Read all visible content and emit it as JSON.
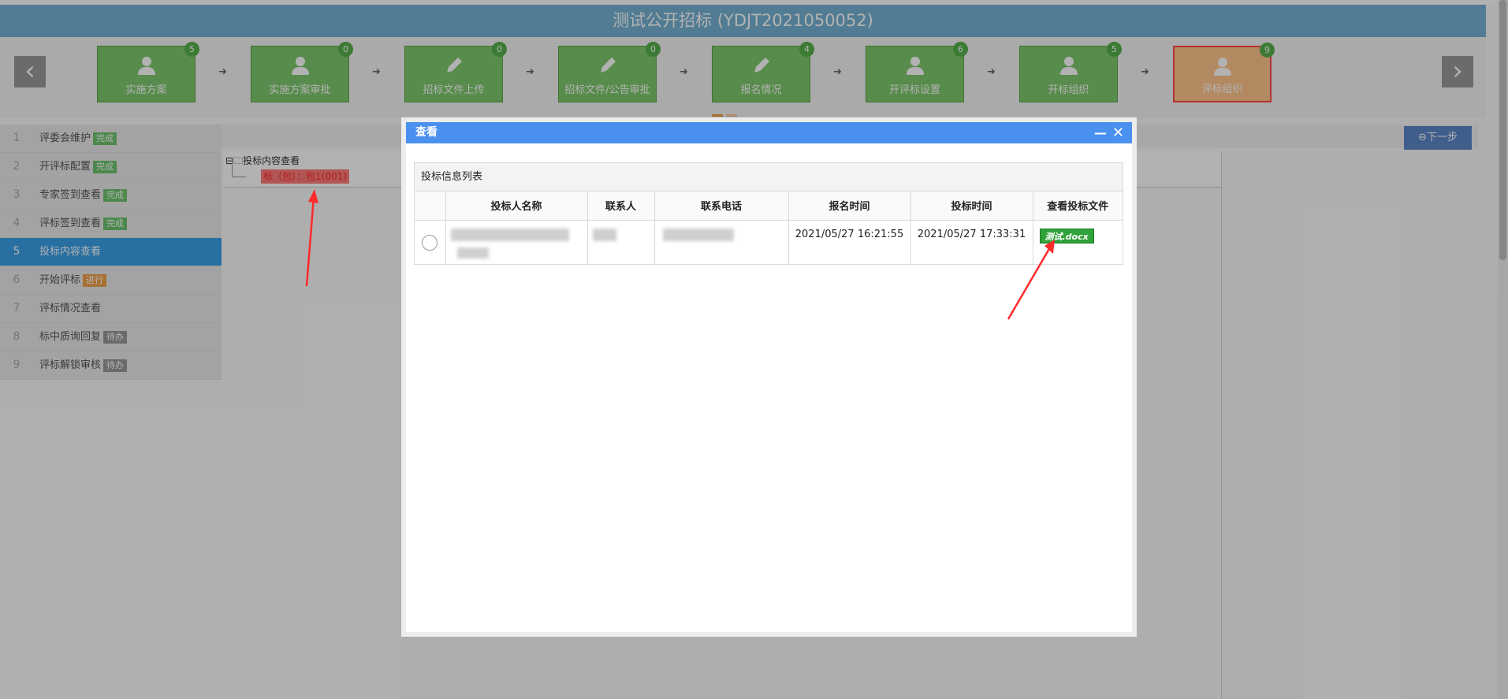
{
  "header": {
    "title": "测试公开招标 (YDJT2021050052)"
  },
  "workflow": {
    "prev_arrow": "‹",
    "next_arrow": "›",
    "steps": [
      {
        "label": "实施方案",
        "count": "5",
        "icon": "user-icon"
      },
      {
        "label": "实施方案审批",
        "count": "0",
        "icon": "user-icon"
      },
      {
        "label": "招标文件上传",
        "count": "0",
        "icon": "pencil-icon"
      },
      {
        "label": "招标文件/公告审批",
        "count": "0",
        "icon": "pencil-icon"
      },
      {
        "label": "报名情况",
        "count": "4",
        "icon": "pencil-icon"
      },
      {
        "label": "开评标设置",
        "count": "6",
        "icon": "user-icon"
      },
      {
        "label": "开标组织",
        "count": "5",
        "icon": "user-icon"
      },
      {
        "label": "评标组织",
        "count": "9",
        "icon": "user-icon",
        "active": true
      }
    ]
  },
  "sidebar": {
    "items": [
      {
        "num": "1",
        "label": "评委会维护",
        "tag": "完成",
        "tag_color": "#6ec36e"
      },
      {
        "num": "2",
        "label": "开评标配置",
        "tag": "完成",
        "tag_color": "#6ec36e"
      },
      {
        "num": "3",
        "label": "专家签到查看",
        "tag": "完成",
        "tag_color": "#6ec36e"
      },
      {
        "num": "4",
        "label": "评标签到查看",
        "tag": "完成",
        "tag_color": "#6ec36e"
      },
      {
        "num": "5",
        "label": "投标内容查看",
        "tag": "",
        "active": true
      },
      {
        "num": "6",
        "label": "开始评标",
        "tag": "进行",
        "tag_color": "#f0a34a"
      },
      {
        "num": "7",
        "label": "评标情况查看",
        "tag": ""
      },
      {
        "num": "8",
        "label": "标中质询回复",
        "tag": "待办",
        "tag_color": "#999999"
      },
      {
        "num": "9",
        "label": "评标解锁审核",
        "tag": "待办",
        "tag_color": "#999999"
      }
    ]
  },
  "toolbar": {
    "next_step": "下一步"
  },
  "tree": {
    "root": "投标内容查看",
    "child": "标（包）：包1(001)"
  },
  "dialog": {
    "title": "查看",
    "grid_caption": "投标信息列表",
    "columns": [
      "投标人名称",
      "联系人",
      "联系电话",
      "报名时间",
      "投标时间",
      "查看投标文件"
    ],
    "rows": [
      {
        "bidder": "",
        "contact": "",
        "phone": "",
        "signup_time": "2021/05/27 16:21:55",
        "bid_time": "2021/05/27 17:33:31",
        "file": "测试.docx"
      }
    ]
  },
  "colors": {
    "title_bar": "#75b2d3",
    "step_green": "#7fc96d",
    "step_active": "#ffc58a",
    "dialog_header": "#4a90ef",
    "file_link": "#2fa23a",
    "annotation": "#ff2a2a"
  }
}
